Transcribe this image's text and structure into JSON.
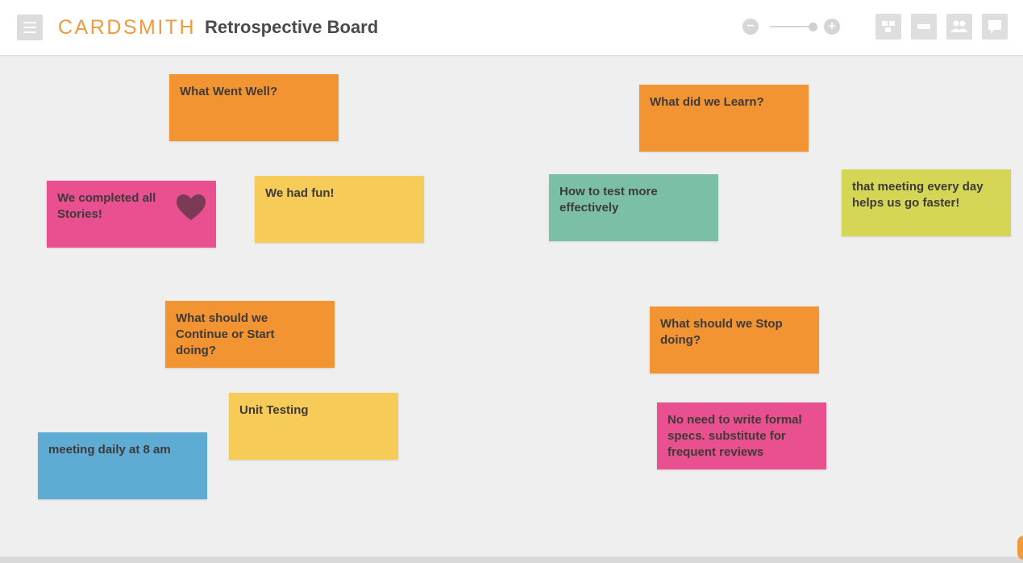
{
  "app": {
    "logo": "CARDSMITH",
    "board_title": "Retrospective Board",
    "accent_color": "#ef9a3d"
  },
  "icons": {
    "menu": "hamburger-menu-icon",
    "zoom_out": "minus-circle-icon",
    "zoom_in": "plus-circle-icon",
    "layout": "layout-grid-icon",
    "card": "card-icon",
    "users": "users-icon",
    "comments": "comment-icon"
  },
  "zoom": {
    "out_symbol": "−",
    "in_symbol": "+"
  },
  "colors": {
    "orange": "#f29432",
    "yellow": "#f7cb57",
    "pink": "#e8508f",
    "teal": "#7bbfa5",
    "lime": "#d5d656",
    "blue": "#5eabd4",
    "heart": "#7b3b57"
  },
  "cards": [
    {
      "id": "what-went-well",
      "text": "What Went Well?",
      "color": "#f29432"
    },
    {
      "id": "what-did-we-learn",
      "text": "What did we Learn?",
      "color": "#f29432"
    },
    {
      "id": "we-completed-all-stories",
      "text": "We completed all Stories!",
      "color": "#e8508f",
      "icon": "heart-icon"
    },
    {
      "id": "we-had-fun",
      "text": "We had fun!",
      "color": "#f7cb57"
    },
    {
      "id": "how-to-test",
      "text": "How to test more effectively",
      "color": "#7bbfa5"
    },
    {
      "id": "meeting-every-day",
      "text": "that meeting every day helps us go faster!",
      "color": "#d5d656"
    },
    {
      "id": "continue-or-start",
      "text": "What should we Continue or Start doing?",
      "color": "#f29432"
    },
    {
      "id": "stop-doing",
      "text": "What should we Stop doing?",
      "color": "#f29432"
    },
    {
      "id": "unit-testing",
      "text": "Unit Testing",
      "color": "#f7cb57"
    },
    {
      "id": "meeting-daily",
      "text": "meeting daily at 8 am",
      "color": "#5eabd4"
    },
    {
      "id": "no-formal-specs",
      "text": "No need to write formal specs. substitute for frequent reviews",
      "color": "#e8508f"
    }
  ]
}
